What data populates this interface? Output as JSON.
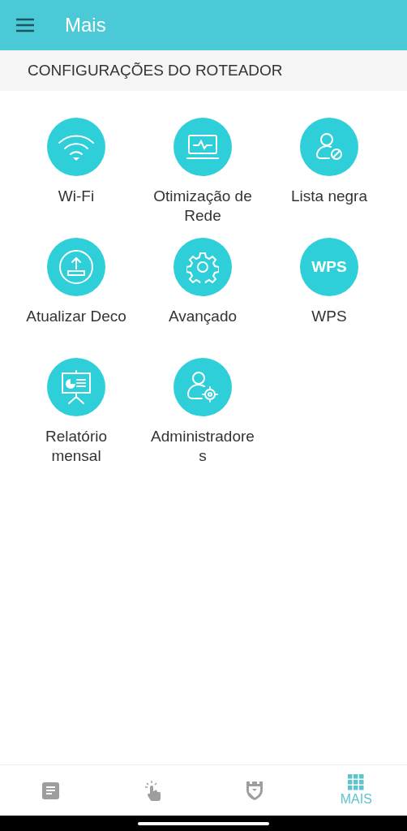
{
  "app_bar": {
    "title": "Mais"
  },
  "section": {
    "title": "CONFIGURAÇÕES DO ROTEADOR"
  },
  "items": [
    {
      "kind": "wifi",
      "label": "Wi-Fi"
    },
    {
      "kind": "monitor",
      "label": "Otimização de Rede"
    },
    {
      "kind": "blocked-user",
      "label": "Lista negra"
    },
    {
      "kind": "upload",
      "label": "Atualizar Deco"
    },
    {
      "kind": "gear",
      "label": "Avançado"
    },
    {
      "kind": "text",
      "badge": "WPS",
      "label": "WPS"
    },
    {
      "kind": "report",
      "label": "Relatório mensal"
    },
    {
      "kind": "admin",
      "label": "Administradores"
    }
  ],
  "bottom_nav": [
    {
      "kind": "document",
      "selected": false
    },
    {
      "kind": "tap",
      "selected": false
    },
    {
      "kind": "shield",
      "selected": false
    },
    {
      "kind": "grid",
      "label": "MAIS",
      "selected": true
    }
  ]
}
